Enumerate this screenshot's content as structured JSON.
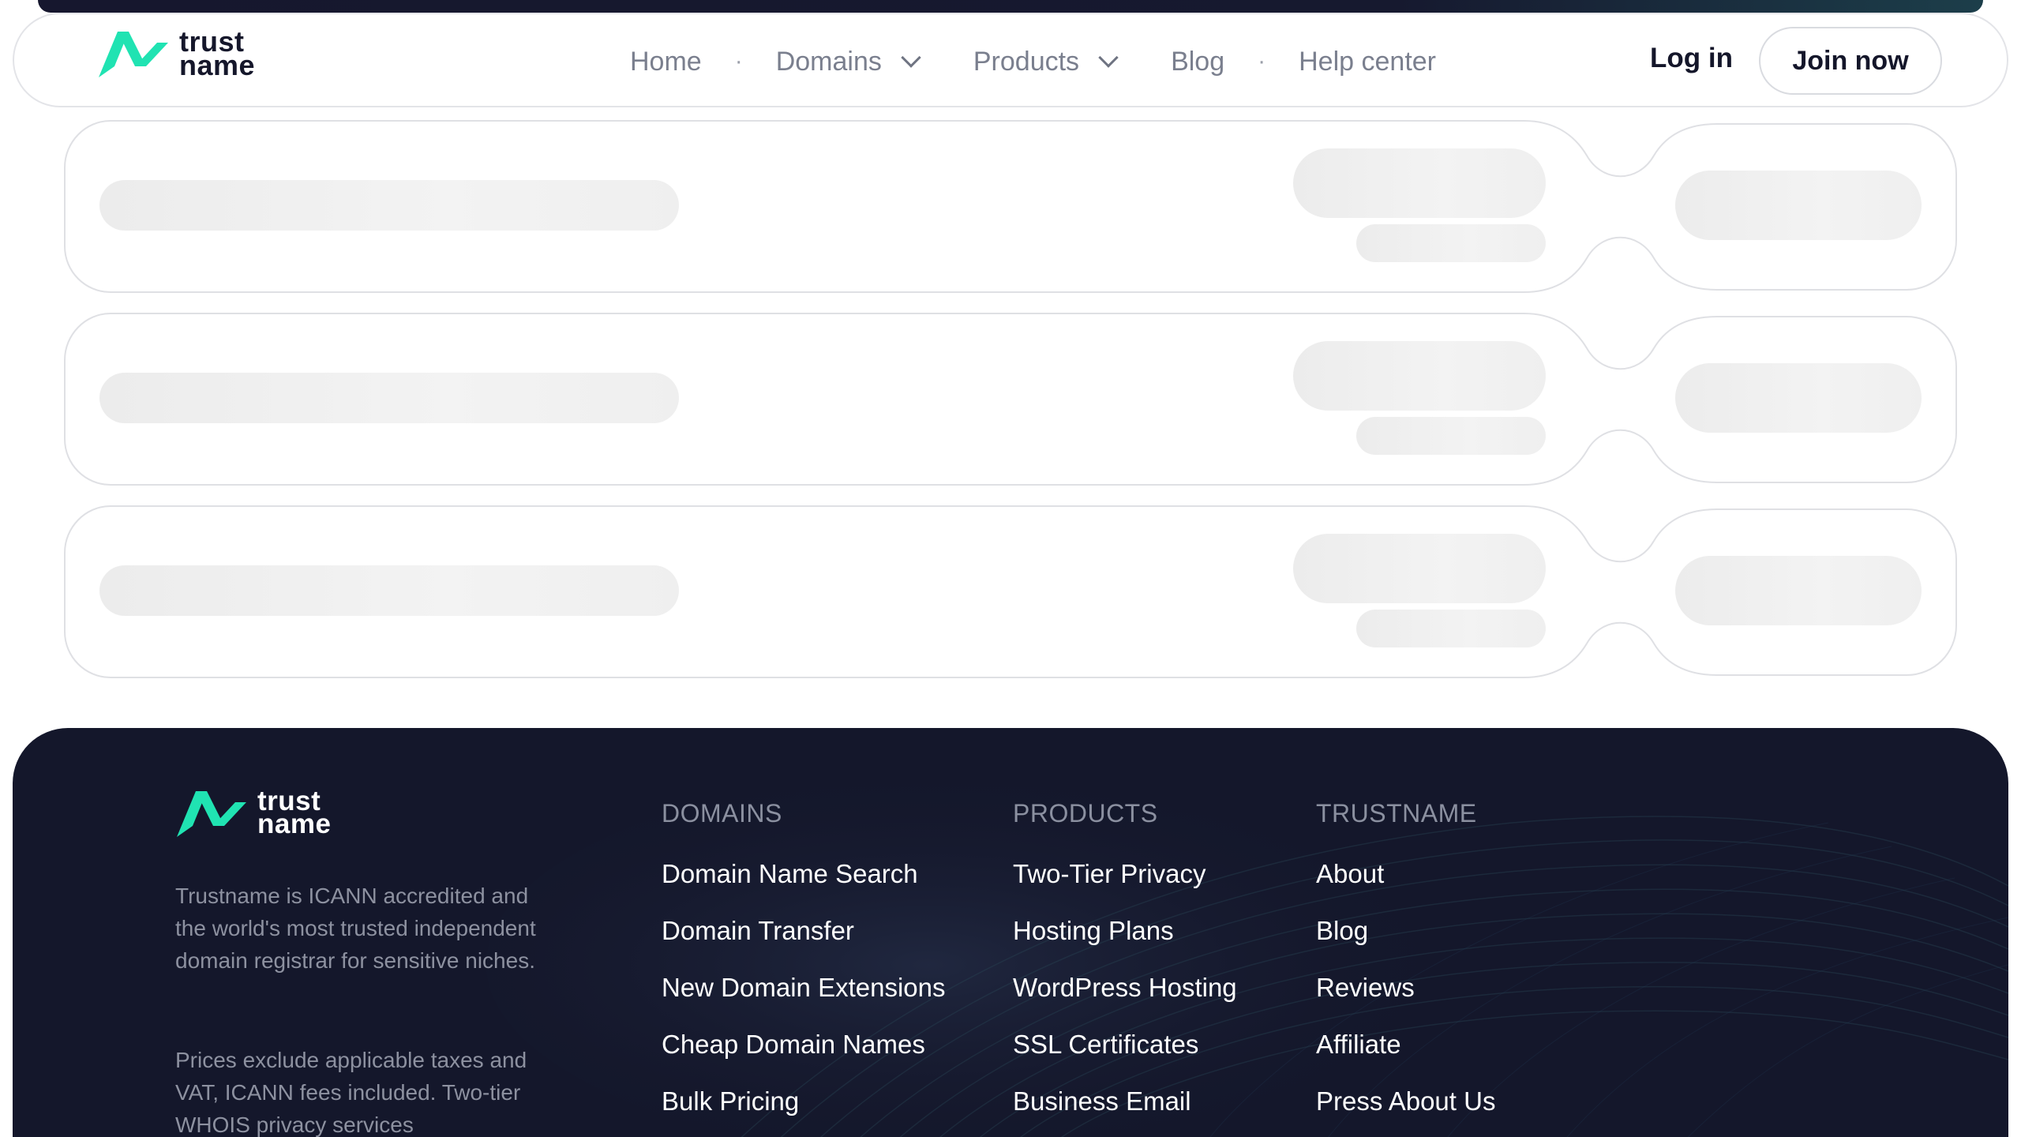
{
  "brand": {
    "word_top": "trust",
    "word_bottom": "name",
    "accent": "#20e3b2"
  },
  "nav": {
    "items": [
      {
        "label": "Home"
      },
      {
        "label": "Domains"
      },
      {
        "label": "Products"
      },
      {
        "label": "Blog"
      },
      {
        "label": "Help center"
      }
    ],
    "separator": "·",
    "login_label": "Log in",
    "join_label": "Join now"
  },
  "footer": {
    "about": "Trustname is ICANN accredited and the world's most trusted independent domain registrar for sensitive niches.",
    "prices_note": "Prices exclude applicable taxes and VAT, ICANN fees included. Two-tier WHOIS privacy services",
    "columns": [
      {
        "heading": "DOMAINS",
        "links": [
          "Domain Name Search",
          "Domain Transfer",
          "New Domain Extensions",
          "Cheap Domain Names",
          "Bulk Pricing"
        ]
      },
      {
        "heading": "PRODUCTS",
        "links": [
          "Two-Tier Privacy",
          "Hosting Plans",
          "WordPress Hosting",
          "SSL Certificates",
          "Business Email"
        ]
      },
      {
        "heading": "TRUSTNAME",
        "links": [
          "About",
          "Blog",
          "Reviews",
          "Affiliate",
          "Press About Us"
        ]
      }
    ]
  },
  "colors": {
    "footer_bg": "#14172b",
    "skeleton": "#efefef",
    "border": "#e3e4e8"
  }
}
